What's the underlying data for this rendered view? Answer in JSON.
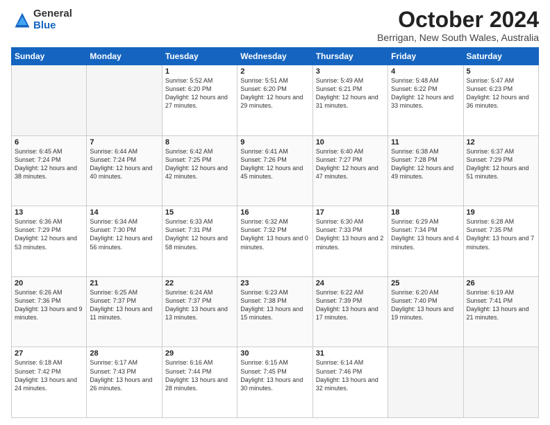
{
  "logo": {
    "general": "General",
    "blue": "Blue"
  },
  "header": {
    "month": "October 2024",
    "location": "Berrigan, New South Wales, Australia"
  },
  "weekdays": [
    "Sunday",
    "Monday",
    "Tuesday",
    "Wednesday",
    "Thursday",
    "Friday",
    "Saturday"
  ],
  "weeks": [
    [
      {
        "day": "",
        "empty": true
      },
      {
        "day": "",
        "empty": true
      },
      {
        "day": "1",
        "sunrise": "5:52 AM",
        "sunset": "6:20 PM",
        "daylight": "12 hours and 27 minutes."
      },
      {
        "day": "2",
        "sunrise": "5:51 AM",
        "sunset": "6:20 PM",
        "daylight": "12 hours and 29 minutes."
      },
      {
        "day": "3",
        "sunrise": "5:49 AM",
        "sunset": "6:21 PM",
        "daylight": "12 hours and 31 minutes."
      },
      {
        "day": "4",
        "sunrise": "5:48 AM",
        "sunset": "6:22 PM",
        "daylight": "12 hours and 33 minutes."
      },
      {
        "day": "5",
        "sunrise": "5:47 AM",
        "sunset": "6:23 PM",
        "daylight": "12 hours and 36 minutes."
      }
    ],
    [
      {
        "day": "6",
        "sunrise": "6:45 AM",
        "sunset": "7:24 PM",
        "daylight": "12 hours and 38 minutes."
      },
      {
        "day": "7",
        "sunrise": "6:44 AM",
        "sunset": "7:24 PM",
        "daylight": "12 hours and 40 minutes."
      },
      {
        "day": "8",
        "sunrise": "6:42 AM",
        "sunset": "7:25 PM",
        "daylight": "12 hours and 42 minutes."
      },
      {
        "day": "9",
        "sunrise": "6:41 AM",
        "sunset": "7:26 PM",
        "daylight": "12 hours and 45 minutes."
      },
      {
        "day": "10",
        "sunrise": "6:40 AM",
        "sunset": "7:27 PM",
        "daylight": "12 hours and 47 minutes."
      },
      {
        "day": "11",
        "sunrise": "6:38 AM",
        "sunset": "7:28 PM",
        "daylight": "12 hours and 49 minutes."
      },
      {
        "day": "12",
        "sunrise": "6:37 AM",
        "sunset": "7:29 PM",
        "daylight": "12 hours and 51 minutes."
      }
    ],
    [
      {
        "day": "13",
        "sunrise": "6:36 AM",
        "sunset": "7:29 PM",
        "daylight": "12 hours and 53 minutes."
      },
      {
        "day": "14",
        "sunrise": "6:34 AM",
        "sunset": "7:30 PM",
        "daylight": "12 hours and 56 minutes."
      },
      {
        "day": "15",
        "sunrise": "6:33 AM",
        "sunset": "7:31 PM",
        "daylight": "12 hours and 58 minutes."
      },
      {
        "day": "16",
        "sunrise": "6:32 AM",
        "sunset": "7:32 PM",
        "daylight": "13 hours and 0 minutes."
      },
      {
        "day": "17",
        "sunrise": "6:30 AM",
        "sunset": "7:33 PM",
        "daylight": "13 hours and 2 minutes."
      },
      {
        "day": "18",
        "sunrise": "6:29 AM",
        "sunset": "7:34 PM",
        "daylight": "13 hours and 4 minutes."
      },
      {
        "day": "19",
        "sunrise": "6:28 AM",
        "sunset": "7:35 PM",
        "daylight": "13 hours and 7 minutes."
      }
    ],
    [
      {
        "day": "20",
        "sunrise": "6:26 AM",
        "sunset": "7:36 PM",
        "daylight": "13 hours and 9 minutes."
      },
      {
        "day": "21",
        "sunrise": "6:25 AM",
        "sunset": "7:37 PM",
        "daylight": "13 hours and 11 minutes."
      },
      {
        "day": "22",
        "sunrise": "6:24 AM",
        "sunset": "7:37 PM",
        "daylight": "13 hours and 13 minutes."
      },
      {
        "day": "23",
        "sunrise": "6:23 AM",
        "sunset": "7:38 PM",
        "daylight": "13 hours and 15 minutes."
      },
      {
        "day": "24",
        "sunrise": "6:22 AM",
        "sunset": "7:39 PM",
        "daylight": "13 hours and 17 minutes."
      },
      {
        "day": "25",
        "sunrise": "6:20 AM",
        "sunset": "7:40 PM",
        "daylight": "13 hours and 19 minutes."
      },
      {
        "day": "26",
        "sunrise": "6:19 AM",
        "sunset": "7:41 PM",
        "daylight": "13 hours and 21 minutes."
      }
    ],
    [
      {
        "day": "27",
        "sunrise": "6:18 AM",
        "sunset": "7:42 PM",
        "daylight": "13 hours and 24 minutes."
      },
      {
        "day": "28",
        "sunrise": "6:17 AM",
        "sunset": "7:43 PM",
        "daylight": "13 hours and 26 minutes."
      },
      {
        "day": "29",
        "sunrise": "6:16 AM",
        "sunset": "7:44 PM",
        "daylight": "13 hours and 28 minutes."
      },
      {
        "day": "30",
        "sunrise": "6:15 AM",
        "sunset": "7:45 PM",
        "daylight": "13 hours and 30 minutes."
      },
      {
        "day": "31",
        "sunrise": "6:14 AM",
        "sunset": "7:46 PM",
        "daylight": "13 hours and 32 minutes."
      },
      {
        "day": "",
        "empty": true
      },
      {
        "day": "",
        "empty": true
      }
    ]
  ]
}
